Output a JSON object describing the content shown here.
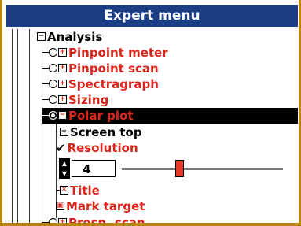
{
  "window": {
    "title": "Expert menu"
  },
  "tree": {
    "root": "Analysis",
    "items": [
      {
        "label": "Pinpoint meter"
      },
      {
        "label": "Pinpoint scan"
      },
      {
        "label": "Spectragraph"
      },
      {
        "label": "Sizing"
      },
      {
        "label": "Polar plot"
      }
    ],
    "sub": [
      {
        "label": "Screen top"
      },
      {
        "label": "Resolution"
      },
      {
        "label": "Title"
      },
      {
        "label": "Mark target"
      }
    ],
    "last": {
      "label": "Presn. scan"
    }
  },
  "resolution_control": {
    "value": "4"
  }
}
